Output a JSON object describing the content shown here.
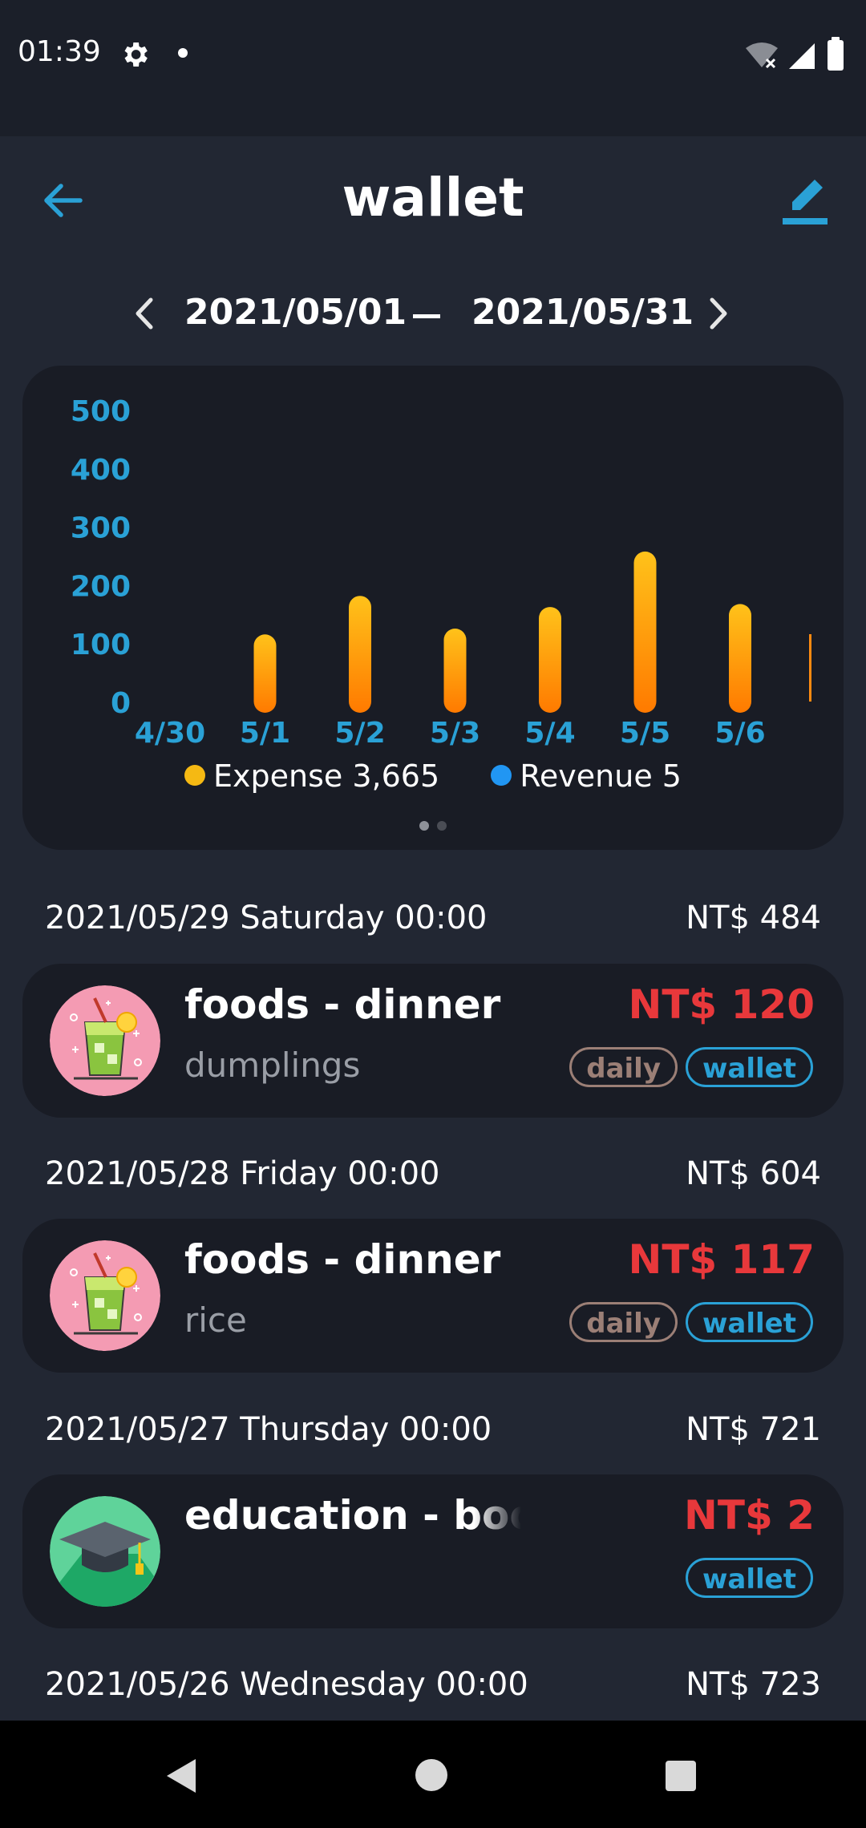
{
  "status_bar": {
    "time": "01:39"
  },
  "header": {
    "title": "wallet"
  },
  "date_range": {
    "start": "2021/05/01",
    "end": "2021/05/31"
  },
  "chart_data": {
    "type": "bar",
    "categories": [
      "4/30",
      "5/1",
      "5/2",
      "5/3",
      "5/4",
      "5/5",
      "5/6"
    ],
    "series": [
      {
        "name": "Expense",
        "values": [
          0,
          115,
          181,
          125,
          162,
          257,
          167
        ]
      },
      {
        "name": "Revenue",
        "values": [
          0,
          0,
          0,
          0,
          0,
          0,
          0
        ]
      }
    ],
    "y_ticks": [
      "500",
      "400",
      "300",
      "200",
      "100",
      "0"
    ],
    "ylim": [
      0,
      500
    ],
    "legend": [
      {
        "label": "Expense 3,665",
        "color": "#f5b913"
      },
      {
        "label": "Revenue 5",
        "color": "#2196f3"
      }
    ],
    "legend_position": "bottom",
    "grid": false
  },
  "colors": {
    "accent": "#2aa1d6",
    "expense_top": "#ffc21a",
    "expense_bottom": "#ff7a00",
    "amount": "#e8383b"
  },
  "days": [
    {
      "date": "2021/05/29 Saturday 00:00",
      "total": "NT$ 484",
      "transactions": [
        {
          "title": "foods - dinner",
          "note": "dumplings",
          "amount": "NT$ 120",
          "tags": [
            "daily",
            "wallet"
          ],
          "icon": "drink-icon"
        }
      ]
    },
    {
      "date": "2021/05/28 Friday 00:00",
      "total": "NT$ 604",
      "transactions": [
        {
          "title": "foods - dinner",
          "note": "rice",
          "amount": "NT$ 117",
          "tags": [
            "daily",
            "wallet"
          ],
          "icon": "drink-icon"
        }
      ]
    },
    {
      "date": "2021/05/27 Thursday 00:00",
      "total": "NT$ 721",
      "transactions": [
        {
          "title": "education - book",
          "note": "",
          "amount": "NT$ 2",
          "tags": [
            "wallet"
          ],
          "icon": "graduation-cap-icon"
        }
      ]
    },
    {
      "date": "2021/05/26 Wednesday 00:00",
      "total": "NT$ 723",
      "transactions": []
    }
  ]
}
